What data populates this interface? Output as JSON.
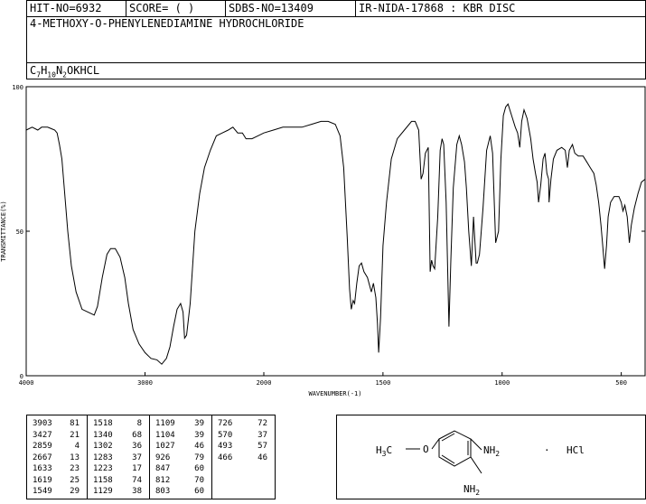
{
  "header": {
    "hit_no": "HIT-NO=6932",
    "score": "SCORE=  (   )",
    "sdbs_no": "SDBS-NO=13409",
    "ir_info": "IR-NIDA-17868 : KBR DISC",
    "compound_name": "4-METHOXY-O-PHENYLENEDIAMINE HYDROCHLORIDE",
    "formula": {
      "c": "C",
      "c_n": "7",
      "h": "H",
      "h_n": "10",
      "n": "N",
      "n_n": "2",
      "rest": "OKHCL"
    }
  },
  "chart_data": {
    "type": "line",
    "title": "",
    "xlabel": "WAVENUMBER(-1)",
    "ylabel": "TRANSMITTANCE(%)",
    "xlim": [
      4000,
      400
    ],
    "ylim": [
      0,
      100
    ],
    "x_ticks": [
      4000,
      3000,
      2000,
      1500,
      1000,
      500
    ],
    "y_ticks": [
      0,
      50,
      100
    ],
    "grid": false,
    "series": [
      {
        "points": [
          [
            4000,
            85
          ],
          [
            3950,
            86
          ],
          [
            3903,
            85
          ],
          [
            3870,
            86
          ],
          [
            3820,
            86
          ],
          [
            3790,
            85.5
          ],
          [
            3760,
            85
          ],
          [
            3740,
            84
          ],
          [
            3720,
            80
          ],
          [
            3700,
            75
          ],
          [
            3680,
            65
          ],
          [
            3650,
            50
          ],
          [
            3620,
            38
          ],
          [
            3580,
            29
          ],
          [
            3530,
            23
          ],
          [
            3480,
            22
          ],
          [
            3427,
            21
          ],
          [
            3400,
            24
          ],
          [
            3360,
            34
          ],
          [
            3320,
            42
          ],
          [
            3290,
            44
          ],
          [
            3250,
            44
          ],
          [
            3210,
            41
          ],
          [
            3170,
            34
          ],
          [
            3140,
            25
          ],
          [
            3100,
            16
          ],
          [
            3050,
            11
          ],
          [
            3000,
            8
          ],
          [
            2950,
            6
          ],
          [
            2900,
            5.5
          ],
          [
            2859,
            4
          ],
          [
            2820,
            6
          ],
          [
            2790,
            10
          ],
          [
            2760,
            17
          ],
          [
            2730,
            23
          ],
          [
            2700,
            25
          ],
          [
            2680,
            22
          ],
          [
            2667,
            13
          ],
          [
            2650,
            14
          ],
          [
            2620,
            25
          ],
          [
            2580,
            50
          ],
          [
            2540,
            63
          ],
          [
            2500,
            72
          ],
          [
            2450,
            78
          ],
          [
            2400,
            83
          ],
          [
            2350,
            84
          ],
          [
            2300,
            85
          ],
          [
            2260,
            86
          ],
          [
            2220,
            84
          ],
          [
            2180,
            84
          ],
          [
            2150,
            82
          ],
          [
            2100,
            82
          ],
          [
            2050,
            83
          ],
          [
            2000,
            84
          ],
          [
            1960,
            85
          ],
          [
            1920,
            86
          ],
          [
            1880,
            86
          ],
          [
            1840,
            86
          ],
          [
            1800,
            87
          ],
          [
            1760,
            88
          ],
          [
            1730,
            88
          ],
          [
            1700,
            87
          ],
          [
            1680,
            83
          ],
          [
            1665,
            72
          ],
          [
            1650,
            48
          ],
          [
            1640,
            30
          ],
          [
            1633,
            23
          ],
          [
            1625,
            26
          ],
          [
            1619,
            25
          ],
          [
            1610,
            32
          ],
          [
            1600,
            38
          ],
          [
            1590,
            39
          ],
          [
            1580,
            36
          ],
          [
            1565,
            34
          ],
          [
            1549,
            29
          ],
          [
            1540,
            32
          ],
          [
            1530,
            27
          ],
          [
            1523,
            18
          ],
          [
            1518,
            8
          ],
          [
            1510,
            20
          ],
          [
            1500,
            45
          ],
          [
            1485,
            60
          ],
          [
            1465,
            75
          ],
          [
            1440,
            82
          ],
          [
            1410,
            85
          ],
          [
            1380,
            88
          ],
          [
            1365,
            88
          ],
          [
            1350,
            85
          ],
          [
            1340,
            68
          ],
          [
            1332,
            70
          ],
          [
            1322,
            77
          ],
          [
            1310,
            79
          ],
          [
            1302,
            36
          ],
          [
            1296,
            40
          ],
          [
            1290,
            38
          ],
          [
            1283,
            37
          ],
          [
            1270,
            55
          ],
          [
            1260,
            78
          ],
          [
            1252,
            82
          ],
          [
            1245,
            80
          ],
          [
            1235,
            60
          ],
          [
            1223,
            17
          ],
          [
            1215,
            40
          ],
          [
            1205,
            65
          ],
          [
            1190,
            80
          ],
          [
            1180,
            83
          ],
          [
            1170,
            80
          ],
          [
            1158,
            74
          ],
          [
            1150,
            65
          ],
          [
            1140,
            50
          ],
          [
            1129,
            38
          ],
          [
            1120,
            55
          ],
          [
            1109,
            39
          ],
          [
            1104,
            39
          ],
          [
            1095,
            42
          ],
          [
            1080,
            58
          ],
          [
            1065,
            78
          ],
          [
            1050,
            83
          ],
          [
            1040,
            77
          ],
          [
            1027,
            46
          ],
          [
            1015,
            50
          ],
          [
            1005,
            75
          ],
          [
            995,
            90
          ],
          [
            985,
            93
          ],
          [
            975,
            94
          ],
          [
            960,
            90
          ],
          [
            945,
            86
          ],
          [
            935,
            84
          ],
          [
            926,
            79
          ],
          [
            918,
            88
          ],
          [
            908,
            92
          ],
          [
            895,
            89
          ],
          [
            880,
            82
          ],
          [
            870,
            75
          ],
          [
            860,
            70
          ],
          [
            853,
            67
          ],
          [
            847,
            60
          ],
          [
            838,
            66
          ],
          [
            828,
            75
          ],
          [
            820,
            77
          ],
          [
            812,
            70
          ],
          [
            805,
            68
          ],
          [
            803,
            60
          ],
          [
            795,
            68
          ],
          [
            785,
            75
          ],
          [
            770,
            78
          ],
          [
            750,
            79
          ],
          [
            735,
            78
          ],
          [
            726,
            72
          ],
          [
            718,
            78
          ],
          [
            705,
            80
          ],
          [
            695,
            77
          ],
          [
            680,
            76
          ],
          [
            660,
            76
          ],
          [
            645,
            74
          ],
          [
            630,
            72
          ],
          [
            615,
            70
          ],
          [
            605,
            66
          ],
          [
            595,
            60
          ],
          [
            585,
            52
          ],
          [
            578,
            45
          ],
          [
            570,
            37
          ],
          [
            562,
            45
          ],
          [
            555,
            55
          ],
          [
            545,
            60
          ],
          [
            530,
            62
          ],
          [
            510,
            62
          ],
          [
            500,
            60
          ],
          [
            493,
            57
          ],
          [
            485,
            59
          ],
          [
            475,
            55
          ],
          [
            466,
            46
          ],
          [
            458,
            52
          ],
          [
            445,
            58
          ],
          [
            430,
            63
          ],
          [
            415,
            67
          ],
          [
            400,
            68
          ]
        ]
      }
    ]
  },
  "peaks": [
    [
      [
        "3903",
        "81"
      ],
      [
        "3427",
        "21"
      ],
      [
        "2859",
        "4"
      ],
      [
        "2667",
        "13"
      ],
      [
        "1633",
        "23"
      ],
      [
        "1619",
        "25"
      ],
      [
        "1549",
        "29"
      ]
    ],
    [
      [
        "1518",
        "8"
      ],
      [
        "1340",
        "68"
      ],
      [
        "1302",
        "36"
      ],
      [
        "1283",
        "37"
      ],
      [
        "1223",
        "17"
      ],
      [
        "1158",
        "74"
      ],
      [
        "1129",
        "38"
      ]
    ],
    [
      [
        "1109",
        "39"
      ],
      [
        "1104",
        "39"
      ],
      [
        "1027",
        "46"
      ],
      [
        "926",
        "79"
      ],
      [
        "847",
        "60"
      ],
      [
        "812",
        "70"
      ],
      [
        "803",
        "60"
      ]
    ],
    [
      [
        "726",
        "72"
      ],
      [
        "570",
        "37"
      ],
      [
        "493",
        "57"
      ],
      [
        "466",
        "46"
      ]
    ]
  ],
  "structure": {
    "methoxy_label": {
      "h": "H",
      "h_n": "3",
      "c": "C",
      "o": "O"
    },
    "amine_1": {
      "nh": "NH",
      "n": "2"
    },
    "amine_2": {
      "nh": "NH",
      "n": "2"
    },
    "salt": "HCl",
    "dot": "·"
  }
}
